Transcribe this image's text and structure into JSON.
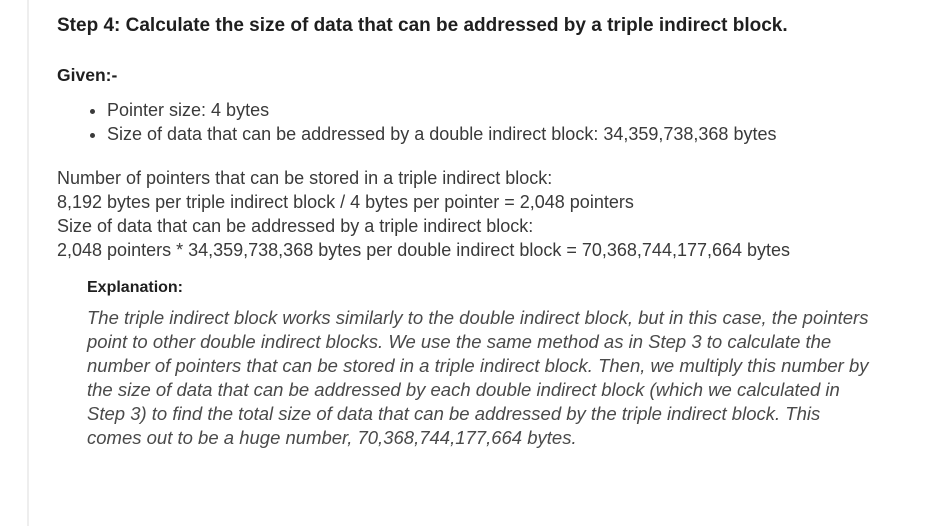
{
  "step": {
    "title": "Step 4: Calculate the size of data that can be addressed by a triple indirect block."
  },
  "given": {
    "label": "Given:-",
    "items": [
      "Pointer size: 4 bytes",
      "Size of data that can be addressed by a double indirect block: 34,359,738,368 bytes"
    ]
  },
  "calculation": {
    "lines": [
      "Number of pointers that can be stored in a triple indirect block:",
      "8,192 bytes per triple indirect block / 4 bytes per pointer = 2,048 pointers",
      "Size of data that can be addressed by a triple indirect block:",
      "2,048 pointers * 34,359,738,368 bytes per double indirect block = 70,368,744,177,664 bytes"
    ]
  },
  "explanation": {
    "label": "Explanation:",
    "text": "The triple indirect block works similarly to the double indirect block, but in this case, the pointers point to other double indirect blocks. We use the same method as in Step 3 to calculate the number of pointers that can be stored in a triple indirect block. Then, we multiply this number by the size of data that can be addressed by each double indirect block (which we calculated in Step 3) to find the total size of data that can be addressed by the triple indirect block. This comes out to be a huge number, 70,368,744,177,664 bytes."
  }
}
